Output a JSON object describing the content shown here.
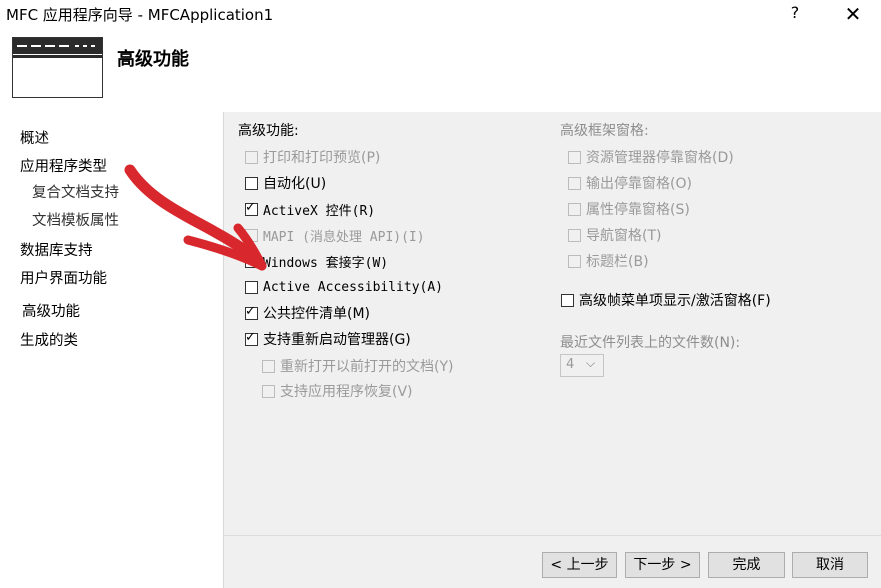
{
  "window": {
    "title": "MFC 应用程序向导 - MFCApplication1",
    "help_label": "?",
    "close_label": "✕"
  },
  "header": {
    "title": "高级功能"
  },
  "sidebar": {
    "items": [
      {
        "label": "概述"
      },
      {
        "label": "应用程序类型"
      },
      {
        "label": "复合文档支持"
      },
      {
        "label": "文档模板属性"
      },
      {
        "label": "数据库支持"
      },
      {
        "label": "用户界面功能"
      },
      {
        "label": "高级功能"
      },
      {
        "label": "生成的类"
      }
    ]
  },
  "main": {
    "features_label": "高级功能:",
    "frame_panes_label": "高级框架窗格:",
    "features": [
      {
        "label": "打印和打印预览(P)",
        "checked": false,
        "enabled": false
      },
      {
        "label": "自动化(U)",
        "checked": false,
        "enabled": true
      },
      {
        "label": "ActiveX 控件(R)",
        "checked": true,
        "enabled": true
      },
      {
        "label": "MAPI (消息处理 API)(I)",
        "checked": false,
        "enabled": false
      },
      {
        "label": "Windows 套接字(W)",
        "checked": true,
        "enabled": true
      },
      {
        "label": "Active Accessibility(A)",
        "checked": false,
        "enabled": true
      },
      {
        "label": "公共控件清单(M)",
        "checked": true,
        "enabled": true
      },
      {
        "label": "支持重新启动管理器(G)",
        "checked": true,
        "enabled": true
      },
      {
        "label": "重新打开以前打开的文档(Y)",
        "checked": false,
        "enabled": false
      },
      {
        "label": "支持应用程序恢复(V)",
        "checked": false,
        "enabled": false
      }
    ],
    "frame_panes": [
      {
        "label": "资源管理器停靠窗格(D)",
        "checked": false,
        "enabled": false
      },
      {
        "label": "输出停靠窗格(O)",
        "checked": false,
        "enabled": false
      },
      {
        "label": "属性停靠窗格(S)",
        "checked": false,
        "enabled": false
      },
      {
        "label": "导航窗格(T)",
        "checked": false,
        "enabled": false
      },
      {
        "label": "标题栏(B)",
        "checked": false,
        "enabled": false
      }
    ],
    "menu_toggle": {
      "label": "高级帧菜单项显示/激活窗格(F)",
      "checked": false,
      "enabled": true
    },
    "recent_files": {
      "label": "最近文件列表上的文件数(N):",
      "value": "4"
    }
  },
  "footer": {
    "back_label": "< 上一步",
    "next_label": "下一步 >",
    "finish_label": "完成",
    "cancel_label": "取消"
  },
  "colors": {
    "annotation_arrow": "#d8282d",
    "panel_bg": "#f0f0f0"
  }
}
